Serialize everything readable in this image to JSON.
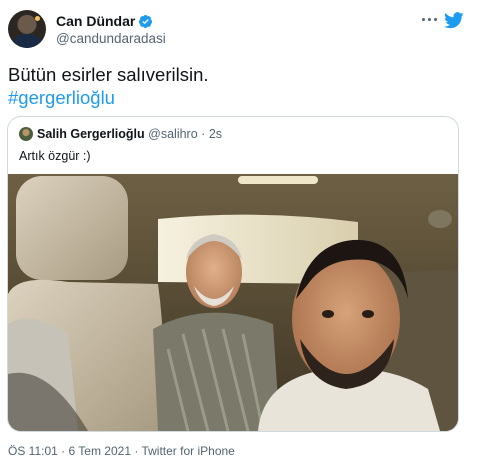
{
  "author": {
    "display_name": "Can Dündar",
    "handle": "@candundaradasi",
    "verified": true
  },
  "tweet": {
    "text": "Bütün esirler salıverilsin.",
    "hashtag": "#gergerlioğlu"
  },
  "quoted_tweet": {
    "display_name": "Salih Gergerlioğlu",
    "handle": "@salihro",
    "separator": "·",
    "time": "2s",
    "text": "Artık özgür :)"
  },
  "footer": {
    "time": "ÖS 11:01",
    "date": "6 Tem 2021",
    "source": "Twitter for iPhone",
    "separator": "·"
  },
  "icons": {
    "verified_badge": "verified-badge-icon",
    "more": "more-icon",
    "brand": "twitter-logo-icon"
  },
  "colors": {
    "accent": "#1d9bf0",
    "text": "#0f1419",
    "secondary_text": "#536471",
    "border": "#cfd9de"
  }
}
